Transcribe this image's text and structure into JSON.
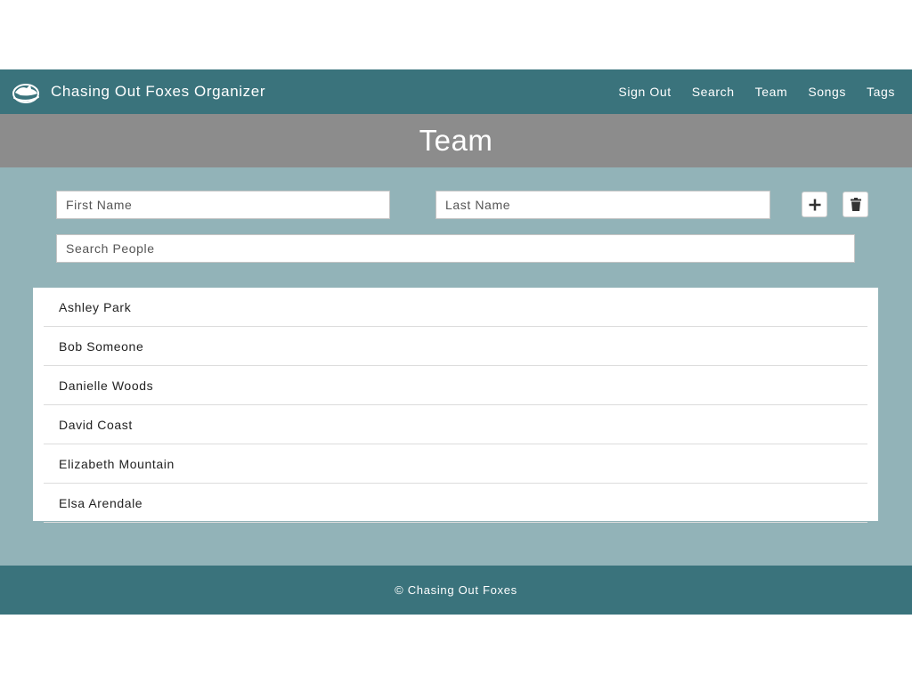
{
  "navbar": {
    "logo_icon": "fox-logo-icon",
    "title": "Chasing Out Foxes Organizer",
    "links": [
      "Sign Out",
      "Search",
      "Team",
      "Songs",
      "Tags"
    ]
  },
  "header": {
    "title": "Team"
  },
  "form": {
    "first_name_placeholder": "First Name",
    "last_name_placeholder": "Last Name",
    "search_placeholder": "Search People",
    "add_icon": "plus-icon",
    "delete_icon": "trash-icon"
  },
  "people": [
    "Ashley Park",
    "Bob Someone",
    "Danielle Woods",
    "David Coast",
    "Elizabeth Mountain",
    "Elsa Arendale"
  ],
  "footer": {
    "text": "© Chasing Out Foxes"
  },
  "colors": {
    "navbar_bg": "#3a737c",
    "header_bg": "#8c8c8c",
    "main_bg": "#92b3b8",
    "footer_bg": "#3a737c"
  }
}
